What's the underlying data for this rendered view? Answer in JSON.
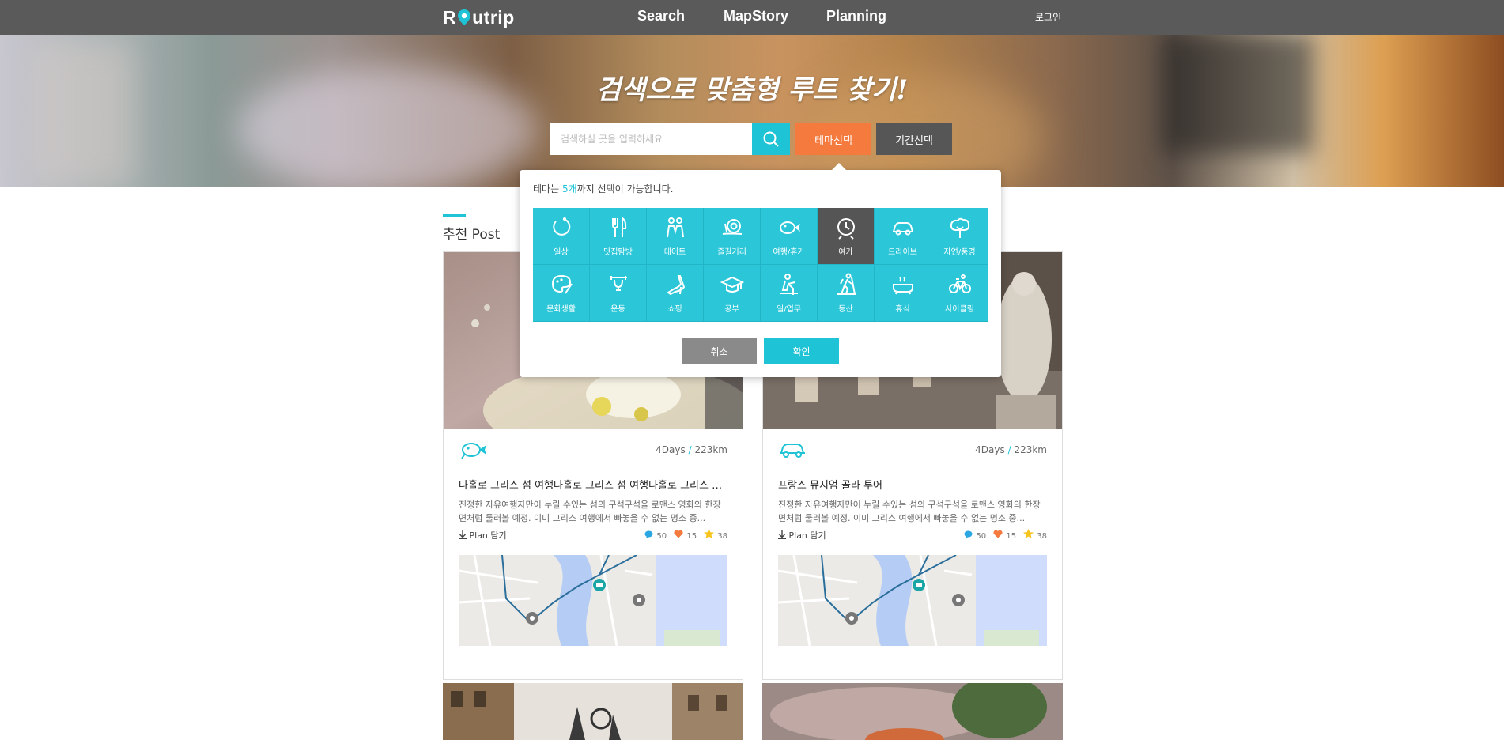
{
  "nav": {
    "logo": "Routrip",
    "links": [
      "Search",
      "MapStory",
      "Planning"
    ],
    "login": "로그인"
  },
  "hero": {
    "title": "검색으로 맞춤형 루트 찾기!",
    "search_placeholder": "검색하실 곳을 입력하세요",
    "theme_button": "테마선택",
    "period_button": "기간선택"
  },
  "section": {
    "title": "추천 Post"
  },
  "cards": [
    {
      "icon": "airplane-fish-icon",
      "days": "4Days",
      "distance": "223km",
      "title": "나홀로 그리스 섬 여행나홀로 그리스 섬 여행나홀로 그리스 섬 여행",
      "desc": "진정한 자유여행자만이 누릴 수있는 섬의 구석구석을 로맨스 영화의 한장면처럼 둘러볼 예정. 이미 그리스 여행에서 빠놓을 수 없는 명소 중...",
      "plan": "Plan 담기",
      "comments": "50",
      "likes": "15",
      "stars": "38"
    },
    {
      "icon": "car-icon",
      "days": "4Days",
      "distance": "223km",
      "title": "프랑스 뮤지엄 골라 투어",
      "desc": "진정한 자유여행자만이 누릴 수있는 섬의 구석구석을 로맨스 영화의 한장면처럼 둘러볼 예정. 이미 그리스 여행에서 빠놓을 수 없는 명소 중...",
      "plan": "Plan 담기",
      "comments": "50",
      "likes": "15",
      "stars": "38"
    }
  ],
  "modal": {
    "notice_prefix": "테마는 ",
    "notice_highlight": "5개",
    "notice_suffix": "까지 선택이 가능합니다.",
    "themes": [
      {
        "label": "일상",
        "icon": "daily-icon",
        "selected": false
      },
      {
        "label": "맛집탐방",
        "icon": "fork-knife-icon",
        "selected": false
      },
      {
        "label": "데이트",
        "icon": "couple-icon",
        "selected": false
      },
      {
        "label": "즐길거리",
        "icon": "snail-icon",
        "selected": false
      },
      {
        "label": "여행/휴가",
        "icon": "airplane-fish-icon",
        "selected": false
      },
      {
        "label": "여가",
        "icon": "clock-icon",
        "selected": true
      },
      {
        "label": "드라이브",
        "icon": "car-icon",
        "selected": false
      },
      {
        "label": "자연/풍경",
        "icon": "tree-icon",
        "selected": false
      },
      {
        "label": "문화생활",
        "icon": "palette-icon",
        "selected": false
      },
      {
        "label": "운동",
        "icon": "dumbbell-icon",
        "selected": false
      },
      {
        "label": "쇼핑",
        "icon": "heel-shoe-icon",
        "selected": false
      },
      {
        "label": "공부",
        "icon": "graduation-cap-icon",
        "selected": false
      },
      {
        "label": "일/업무",
        "icon": "worker-icon",
        "selected": false
      },
      {
        "label": "등산",
        "icon": "hiking-icon",
        "selected": false
      },
      {
        "label": "휴식",
        "icon": "bathtub-icon",
        "selected": false
      },
      {
        "label": "사이클링",
        "icon": "bicycle-icon",
        "selected": false
      }
    ],
    "cancel": "취소",
    "ok": "확인"
  },
  "colors": {
    "accent": "#1ec3d5",
    "orange": "#f47a3e",
    "nav": "#5a5a5a",
    "selected_tile": "#555555"
  }
}
